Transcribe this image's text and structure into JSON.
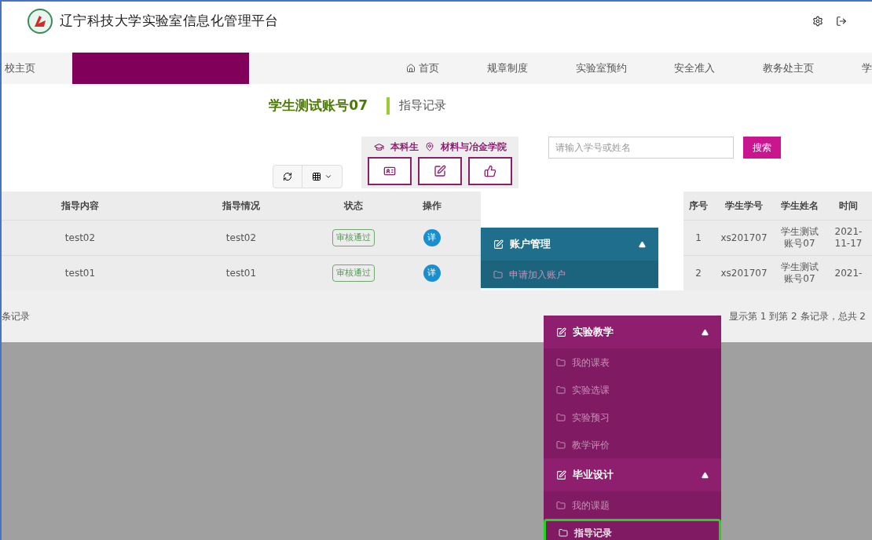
{
  "header": {
    "title": "辽宁科技大学实验室信息化管理平台"
  },
  "nav": [
    {
      "label": "校主页",
      "kind": "text"
    },
    {
      "label": "首页",
      "kind": "home"
    },
    {
      "label": "规章制度",
      "kind": "text"
    },
    {
      "label": "实验室预约",
      "kind": "text"
    },
    {
      "label": "安全准入",
      "kind": "text"
    },
    {
      "label": "教务处主页",
      "kind": "text"
    },
    {
      "label": "学",
      "kind": "text"
    }
  ],
  "user": {
    "name": "学生测试账号07",
    "level": "本科生",
    "college": "材料与冶金学院"
  },
  "page_title": "指导记录",
  "search": {
    "placeholder": "请输入学号或姓名",
    "button": "搜索"
  },
  "left_table": {
    "columns": [
      "指导内容",
      "指导情况",
      "状态",
      "操作"
    ],
    "rows": [
      {
        "content": "test02",
        "situation": "test02",
        "status": "审核通过",
        "action": "详"
      },
      {
        "content": "test01",
        "situation": "test01",
        "status": "审核通过",
        "action": "详"
      }
    ]
  },
  "right_table": {
    "columns": [
      "序号",
      "学生学号",
      "学生姓名",
      "时间"
    ],
    "rows": [
      [
        "1",
        "xs201707",
        "学生测试账号07",
        "2021-11-17"
      ],
      [
        "2",
        "xs201707",
        "学生测试账号07",
        "2021-"
      ]
    ]
  },
  "footer": {
    "left": "条记录",
    "right": "显示第 1 到第 2 条记录，总共 2"
  },
  "sidebar": [
    {
      "title": "账户管理",
      "expanded": true,
      "color": "#1f6e8c",
      "items": [
        {
          "label": "申请加入账户",
          "selected": false
        }
      ]
    },
    {
      "title": "实验教学",
      "expanded": true,
      "color": "#8e1e6e",
      "items": [
        {
          "label": "我的课表",
          "selected": false
        },
        {
          "label": "实验选课",
          "selected": false
        },
        {
          "label": "实验预习",
          "selected": false
        },
        {
          "label": "教学评价",
          "selected": false
        }
      ]
    },
    {
      "title": "毕业设计",
      "expanded": true,
      "color": "#8e1e6e",
      "items": [
        {
          "label": "我的课题",
          "selected": false
        },
        {
          "label": "指导记录",
          "selected": true
        }
      ]
    }
  ]
}
